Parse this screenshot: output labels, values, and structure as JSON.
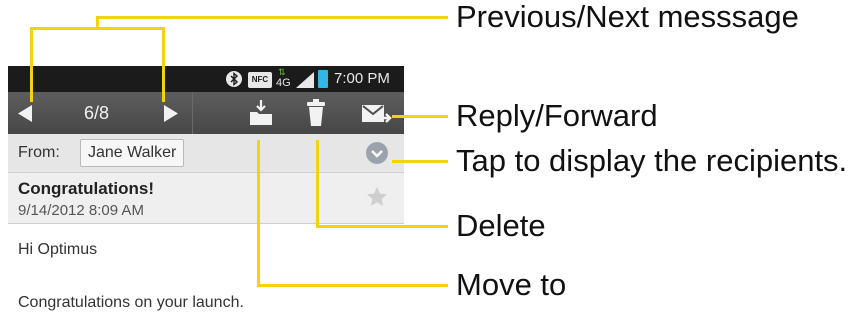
{
  "status_bar": {
    "icons": [
      "bluetooth-icon",
      "nfc-icon",
      "4g-data-icon",
      "signal-icon",
      "battery-icon"
    ],
    "nfc_label": "NFC",
    "net_label": "4G",
    "time": "7:00 PM"
  },
  "action_bar": {
    "counter": "6/8",
    "icons": [
      "previous-arrow-icon",
      "next-arrow-icon",
      "move-to-folder-icon",
      "delete-trash-icon",
      "reply-forward-icon"
    ]
  },
  "email": {
    "from_label": "From:",
    "sender": "Jane Walker",
    "subject": "Congratulations!",
    "date": "9/14/2012 8:09 AM",
    "greeting": "Hi Optimus",
    "body": "Congratulations on your launch."
  },
  "annotations": {
    "prev_next": "Previous/Next messsage",
    "reply_forward": "Reply/Forward",
    "recipients": "Tap to display the recipients.",
    "delete": "Delete",
    "move_to": "Move to"
  },
  "colors": {
    "callout": "#f4d20e",
    "status_bar": "#1b1b1b",
    "action_bar": "#4f4f4f",
    "battery_accent": "#33b5e5",
    "chevron_circle": "#9aa3ad"
  }
}
